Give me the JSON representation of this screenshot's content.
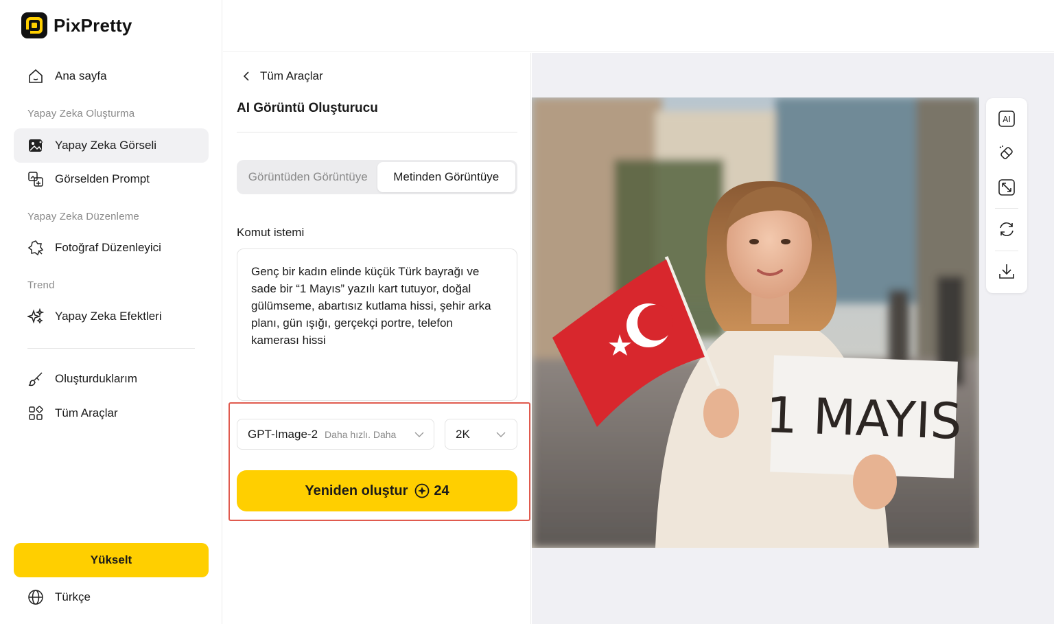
{
  "app": {
    "name": "PixPretty"
  },
  "sidebar": {
    "home": "Ana sayfa",
    "section_create": "Yapay Zeka Oluşturma",
    "ai_image": "Yapay Zeka Görseli",
    "image_to_prompt": "Görselden Prompt",
    "section_edit": "Yapay Zeka Düzenleme",
    "photo_editor": "Fotoğraf Düzenleyici",
    "section_trend": "Trend",
    "ai_effects": "Yapay Zeka Efektleri",
    "my_creations": "Oluşturduklarım",
    "all_tools": "Tüm Araçlar",
    "upgrade": "Yükselt",
    "language": "Türkçe"
  },
  "panel": {
    "back": "Tüm Araçlar",
    "title": "AI Görüntü Oluşturucu",
    "tabs": [
      "Görüntüden Görüntüye",
      "Metinden Görüntüye"
    ],
    "active_tab": "Metinden Görüntüye",
    "prompt_label": "Komut istemi",
    "prompt_value": "Genç bir kadın elinde küçük Türk bayrağı ve sade bir “1 Mayıs” yazılı kart tutuyor, doğal gülümseme, abartısız kutlama hissi, şehir arka planı, gün ışığı, gerçekçi portre, telefon kamerası hissi",
    "model_name": "GPT-Image-2",
    "model_desc": "Daha hızlı. Daha",
    "resolution": "2K",
    "generate": "Yeniden oluştur",
    "credits": "24"
  },
  "image": {
    "sign_text": "1 MAYIS"
  },
  "toolbar": [
    "ai-icon",
    "eraser-icon",
    "expand-icon",
    "refresh-icon",
    "download-icon"
  ],
  "colors": {
    "accent": "#ffcf00",
    "highlight": "#e05a4e"
  }
}
